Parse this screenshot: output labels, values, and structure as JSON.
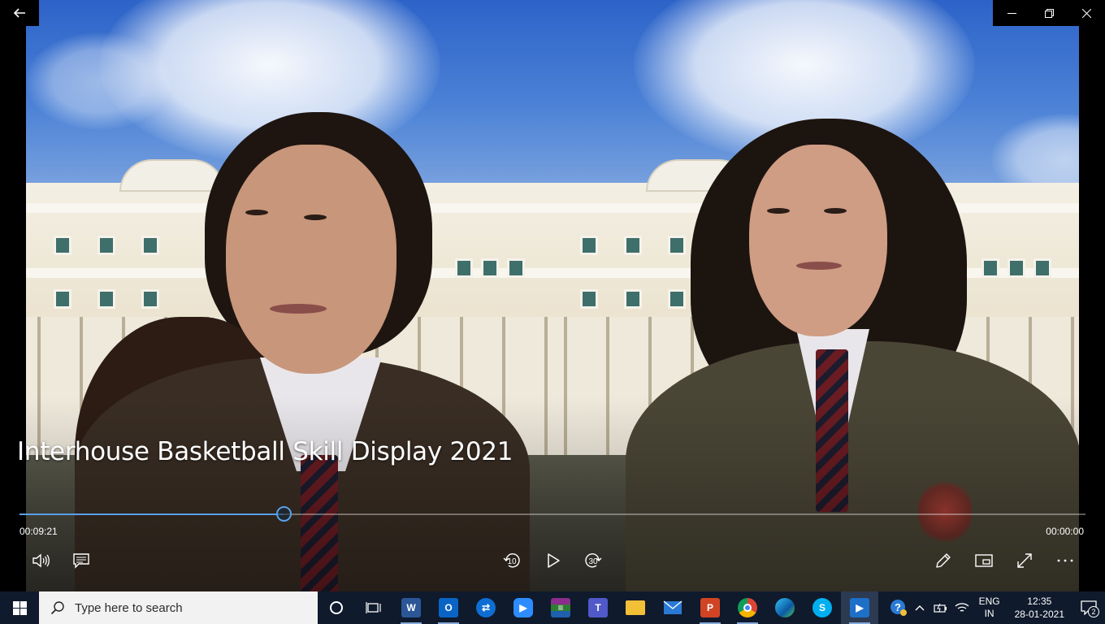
{
  "player": {
    "title": "Interhouse Basketball Skill Display 2021",
    "elapsed": "00:09:21",
    "remaining": "00:00:00",
    "progress_fraction": 0.248,
    "skip_back_label": "10",
    "skip_forward_label": "30"
  },
  "window_controls": [
    "back",
    "minimize",
    "restore",
    "close"
  ],
  "controls": {
    "left": [
      "volume-icon",
      "captions-icon"
    ],
    "center": [
      "skip-back-10-icon",
      "play-icon",
      "skip-forward-30-icon"
    ],
    "right": [
      "edit-pencil-icon",
      "mini-view-icon",
      "fullscreen-icon",
      "more-options-icon"
    ]
  },
  "taskbar": {
    "search_placeholder": "Type here to search",
    "apps": [
      "cortana",
      "task-view",
      "word",
      "outlook",
      "teamviewer",
      "zoom",
      "winrar",
      "teams",
      "file-explorer",
      "mail",
      "powerpoint",
      "chrome",
      "edge",
      "skype",
      "movies-tv"
    ],
    "lang_line1": "ENG",
    "lang_line2": "IN",
    "time": "12:35",
    "date": "28-01-2021",
    "notification_count": "2"
  },
  "colors": {
    "accent": "#5aa0e8",
    "taskbar_bg": "#0f1a2c"
  }
}
